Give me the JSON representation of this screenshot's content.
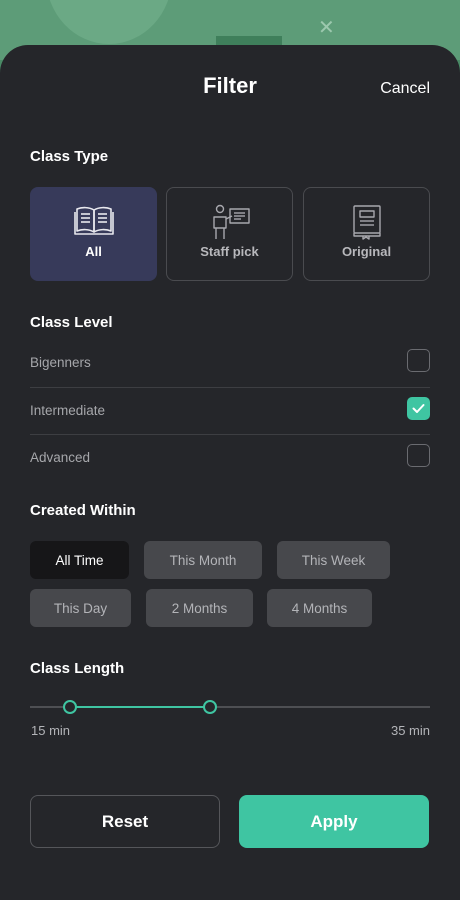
{
  "header": {
    "title": "Filter",
    "cancel_label": "Cancel"
  },
  "class_type": {
    "title": "Class Type",
    "options": [
      {
        "label": "All",
        "icon": "open-book-icon",
        "selected": true
      },
      {
        "label": "Staff pick",
        "icon": "presenter-board-icon",
        "selected": false
      },
      {
        "label": "Original",
        "icon": "closed-book-icon",
        "selected": false
      }
    ]
  },
  "class_level": {
    "title": "Class Level",
    "options": [
      {
        "label": "Bigenners",
        "checked": false
      },
      {
        "label": "Intermediate",
        "checked": true
      },
      {
        "label": "Advanced",
        "checked": false
      }
    ]
  },
  "created_within": {
    "title": "Created Within",
    "options": [
      {
        "label": "All Time",
        "active": true
      },
      {
        "label": "This Month",
        "active": false
      },
      {
        "label": "This Week",
        "active": false
      },
      {
        "label": "This Day",
        "active": false
      },
      {
        "label": "2 Months",
        "active": false
      },
      {
        "label": "4 Months",
        "active": false
      }
    ]
  },
  "class_length": {
    "title": "Class Length",
    "min_label": "15 min",
    "max_label": "35 min",
    "min_value": 15,
    "max_value": 35,
    "range_low": 17,
    "range_high": 24
  },
  "actions": {
    "reset_label": "Reset",
    "apply_label": "Apply"
  },
  "colors": {
    "accent": "#3fc5a2",
    "sheet": "#25262a",
    "selected_card": "#373a5a"
  }
}
